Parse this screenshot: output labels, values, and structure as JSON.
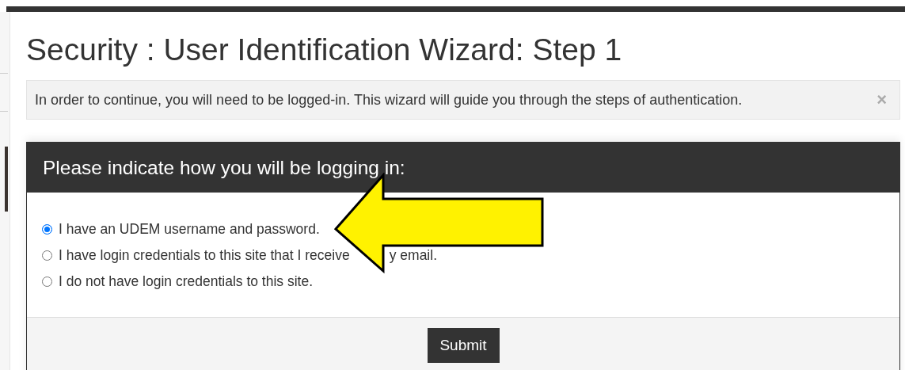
{
  "title": "Security : User Identification Wizard: Step 1",
  "alert": {
    "text": "In order to continue, you will need to be logged-in. This wizard will guide you through the steps of authentication.",
    "close": "×"
  },
  "card": {
    "heading": "Please indicate how you will be logging in:",
    "options": [
      {
        "label": "I have an UDEM username and password.",
        "selected": true
      },
      {
        "label": "I have login credentials to this site that I receive",
        "label_tail": "y email.",
        "selected": false
      },
      {
        "label": "I do not have login credentials to this site.",
        "selected": false
      }
    ],
    "submit": "Submit"
  }
}
